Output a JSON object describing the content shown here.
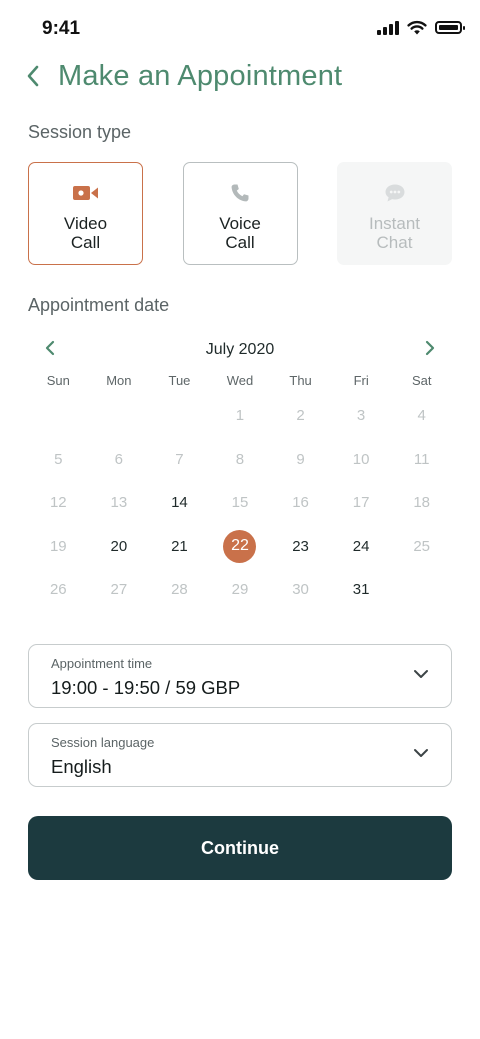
{
  "status_bar": {
    "time": "9:41"
  },
  "header": {
    "title": "Make an Appointment"
  },
  "session": {
    "label": "Session type",
    "options": [
      {
        "label": "Video\nCall",
        "icon": "video-camera-icon",
        "state": "selected"
      },
      {
        "label": "Voice\nCall",
        "icon": "phone-icon",
        "state": "default"
      },
      {
        "label": "Instant\nChat",
        "icon": "chat-bubble-icon",
        "state": "disabled"
      }
    ]
  },
  "date": {
    "label": "Appointment date",
    "month": "July 2020",
    "weekdays": [
      "Sun",
      "Mon",
      "Tue",
      "Wed",
      "Thu",
      "Fri",
      "Sat"
    ],
    "first_weekday_index": 3,
    "days_in_month": 31,
    "available_days": [
      14,
      20,
      21,
      22,
      23,
      24,
      31
    ],
    "selected_day": 22
  },
  "appointment_time": {
    "label": "Appointment time",
    "value": "19:00 - 19:50 / 59 GBP"
  },
  "session_language": {
    "label": "Session language",
    "value": "English"
  },
  "continue_label": "Continue",
  "colors": {
    "accent": "#c9714a",
    "title_green": "#4e8a6f",
    "button_dark": "#1c3a3f",
    "disabled_text": "#bfc4c5"
  }
}
